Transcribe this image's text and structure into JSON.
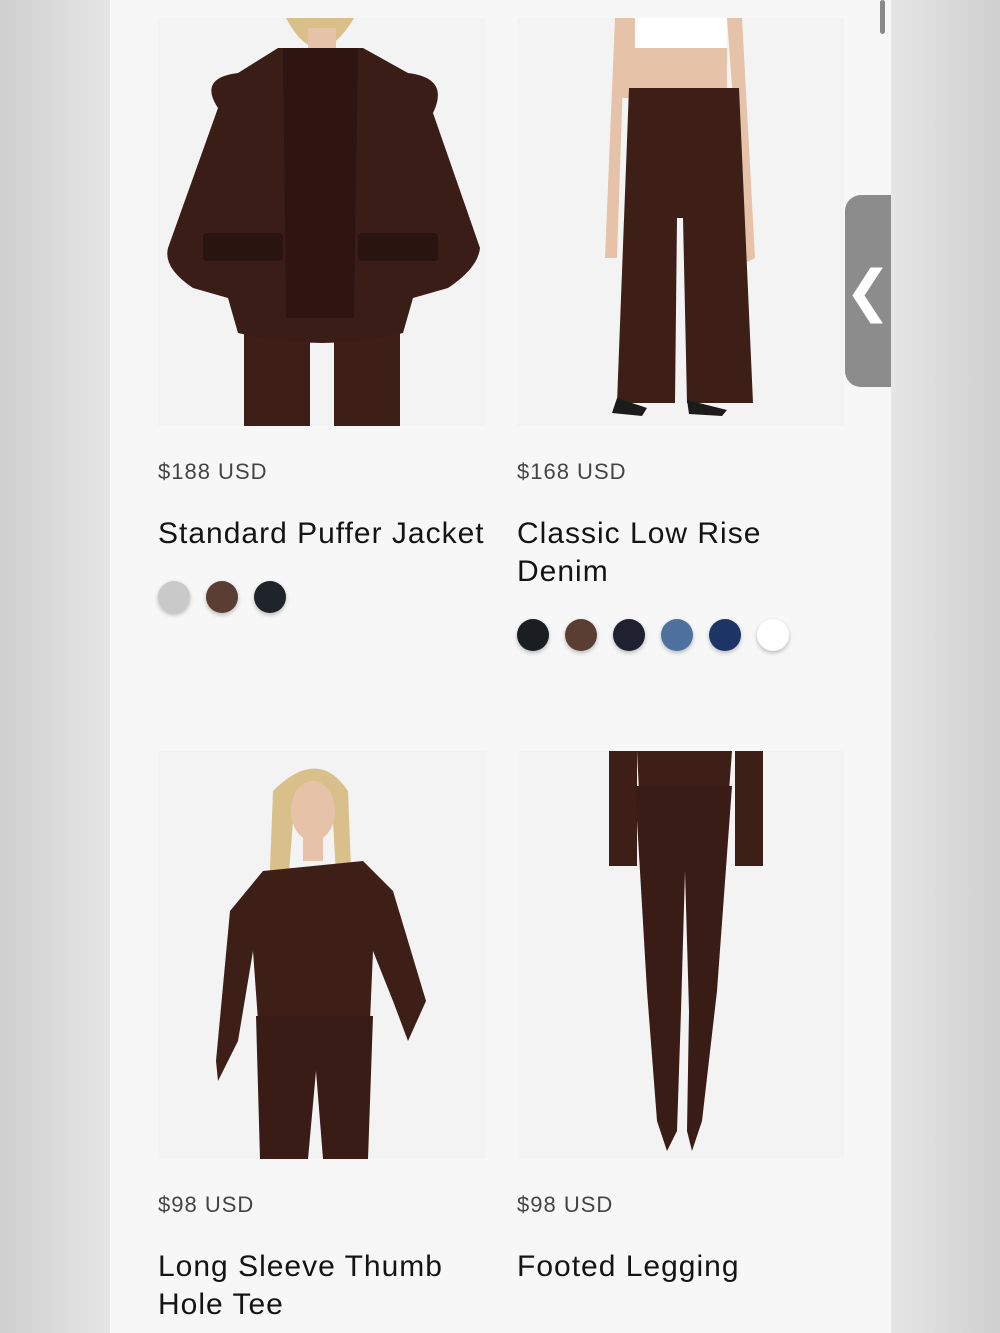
{
  "products": [
    {
      "price": "$188 USD",
      "title": "Standard Puffer Jacket",
      "image_icon": "puffer-jacket-photo",
      "swatches": [
        "#c9c9c9",
        "#5a3e33",
        "#1e2429"
      ]
    },
    {
      "price": "$168 USD",
      "title": "Classic Low Rise Denim",
      "image_icon": "denim-pants-photo",
      "swatches": [
        "#1a1d22",
        "#5a3e33",
        "#1f2030",
        "#4f71a0",
        "#1c3566",
        "#ffffff"
      ]
    },
    {
      "price": "$98 USD",
      "title": "Long Sleeve Thumb Hole Tee",
      "image_icon": "long-sleeve-tee-photo",
      "swatches": []
    },
    {
      "price": "$98 USD",
      "title": "Footed Legging",
      "image_icon": "footed-legging-photo",
      "swatches": []
    }
  ],
  "side_tab_icon": "chevron-left-icon",
  "colors": {
    "garment": "#3d1f18",
    "skin": "#e6c2a8",
    "hair": "#d9c08a"
  }
}
